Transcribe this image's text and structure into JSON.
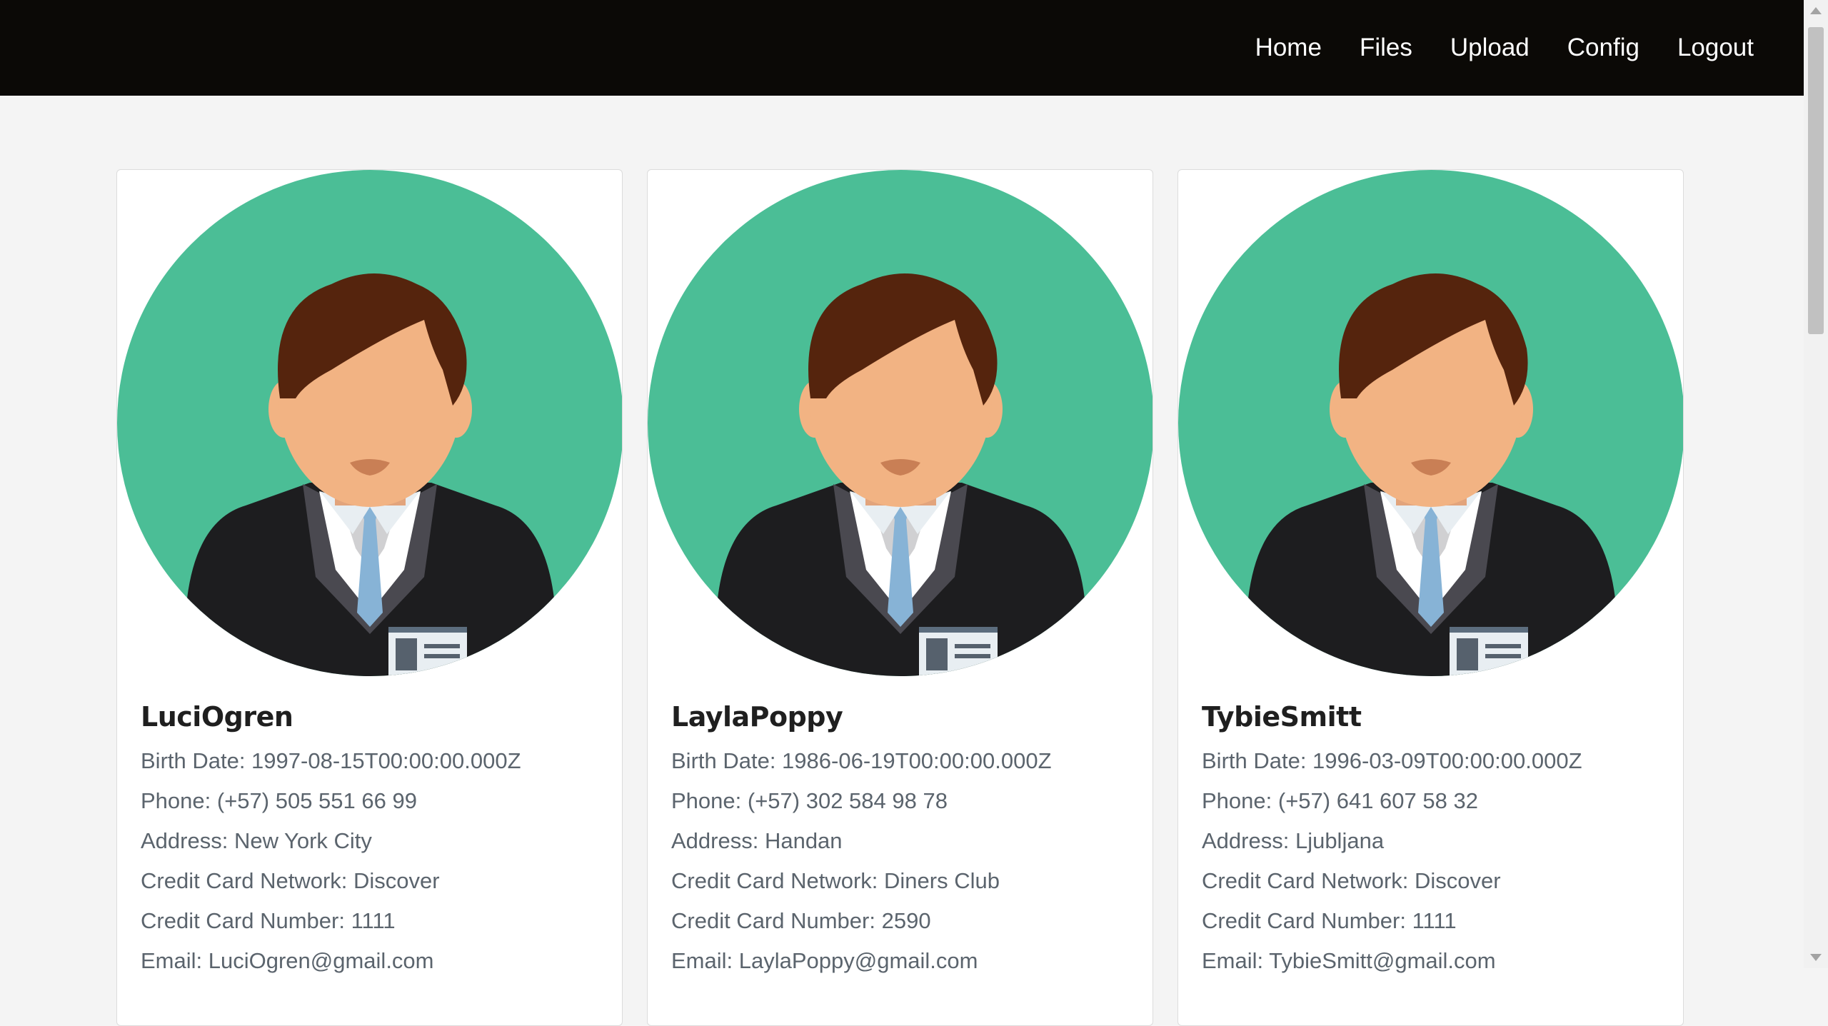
{
  "nav": {
    "links": [
      "Home",
      "Files",
      "Upload",
      "Config",
      "Logout"
    ]
  },
  "colors": {
    "navbar": "#0b0906",
    "background": "#f4f4f4",
    "avatar_circle": "#4bbe96"
  },
  "cards": [
    {
      "name": "LuciOgren",
      "birth": "Birth Date: 1997-08-15T00:00:00.000Z",
      "phone": "Phone: (+57) 505 551 66 99",
      "address": "Address: New York City",
      "network": "Credit Card Network: Discover",
      "number": "Credit Card Number: 1111",
      "email": "Email: LuciOgren@gmail.com"
    },
    {
      "name": "LaylaPoppy",
      "birth": "Birth Date: 1986-06-19T00:00:00.000Z",
      "phone": "Phone: (+57) 302 584 98 78",
      "address": "Address: Handan",
      "network": "Credit Card Network: Diners Club",
      "number": "Credit Card Number: 2590",
      "email": "Email: LaylaPoppy@gmail.com"
    },
    {
      "name": "TybieSmitt",
      "birth": "Birth Date: 1996-03-09T00:00:00.000Z",
      "phone": "Phone: (+57) 641 607 58 32",
      "address": "Address: Ljubljana",
      "network": "Credit Card Network: Discover",
      "number": "Credit Card Number: 1111",
      "email": "Email: TybieSmitt@gmail.com"
    }
  ]
}
